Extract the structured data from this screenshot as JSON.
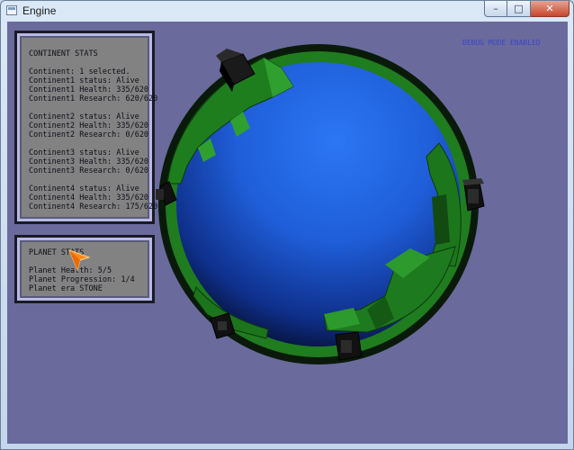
{
  "window": {
    "title": "Engine",
    "min_glyph": "–",
    "max_glyph": "□",
    "close_glyph": "✕"
  },
  "continent_panel": {
    "title": "CONTINENT STATS",
    "selected_line": "Continent: 1 selected.",
    "continents": [
      {
        "status": "Continent1 status: Alive",
        "health": "Continent1 Health: 335/620",
        "research": "Continent1 Research: 620/620"
      },
      {
        "status": "Continent2 status: Alive",
        "health": "Continent2 Health: 335/620",
        "research": "Continent2 Research: 0/620"
      },
      {
        "status": "Continent3 status: Alive",
        "health": "Continent3 Health: 335/620",
        "research": "Continent3 Research: 0/620"
      },
      {
        "status": "Continent4 status: Alive",
        "health": "Continent4 Health: 335/620",
        "research": "Continent4 Research: 175/620"
      }
    ]
  },
  "planet_panel": {
    "title": "PLANET STATS",
    "health": "Planet Health: 5/5",
    "progression": "Planet Progression: 1/4",
    "era": "Planet era STONE"
  },
  "debug_label": "DEBUG MODE ENABLED",
  "colors": {
    "background": "#6a6a9c",
    "planet": "#1f5ed8",
    "continent": "#1e7a1e",
    "tower": "#141414",
    "debug_text": "#3a46c8",
    "panel": "#828282"
  },
  "icons": {
    "window": "app-window-icon",
    "cursor": "orange-arrow-cursor-icon"
  }
}
